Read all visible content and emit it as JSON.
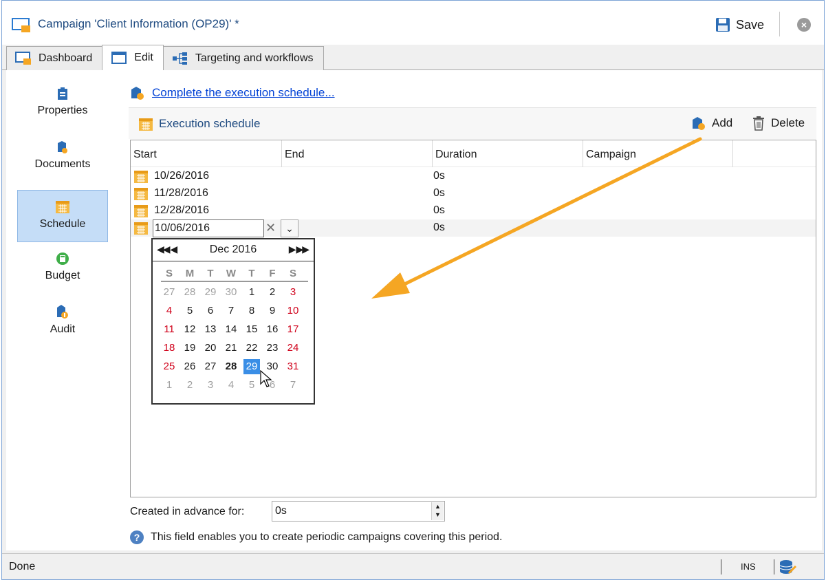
{
  "window": {
    "title": "Campaign 'Client Information (OP29)' *",
    "save_label": "Save"
  },
  "tabs": [
    {
      "label": "Dashboard"
    },
    {
      "label": "Edit"
    },
    {
      "label": "Targeting and workflows"
    }
  ],
  "sidebar": [
    {
      "label": "Properties",
      "icon": "clipboard-icon"
    },
    {
      "label": "Documents",
      "icon": "document-icon"
    },
    {
      "label": "Schedule",
      "icon": "calendar-icon",
      "active": true
    },
    {
      "label": "Budget",
      "icon": "budget-icon"
    },
    {
      "label": "Audit",
      "icon": "audit-icon"
    }
  ],
  "main": {
    "link": "Complete the execution schedule...",
    "toolbar_title": "Execution schedule",
    "add_label": "Add",
    "delete_label": "Delete"
  },
  "grid": {
    "columns": [
      "Start",
      "End",
      "Duration",
      "Campaign"
    ],
    "rows": [
      {
        "start": "10/26/2016",
        "end": "",
        "duration": "0s",
        "campaign": ""
      },
      {
        "start": "11/28/2016",
        "end": "",
        "duration": "0s",
        "campaign": ""
      },
      {
        "start": "12/28/2016",
        "end": "",
        "duration": "0s",
        "campaign": ""
      },
      {
        "start": "10/06/2016",
        "end": "",
        "duration": "0s",
        "campaign": "",
        "editing": true
      }
    ]
  },
  "calendar": {
    "month_label": "Dec 2016",
    "weekdays": [
      "S",
      "M",
      "T",
      "W",
      "T",
      "F",
      "S"
    ],
    "weeks": [
      [
        "27",
        "28",
        "29",
        "30",
        "1",
        "2",
        "3"
      ],
      [
        "4",
        "5",
        "6",
        "7",
        "8",
        "9",
        "10"
      ],
      [
        "11",
        "12",
        "13",
        "14",
        "15",
        "16",
        "17"
      ],
      [
        "18",
        "19",
        "20",
        "21",
        "22",
        "23",
        "24"
      ],
      [
        "25",
        "26",
        "27",
        "28",
        "29",
        "30",
        "31"
      ],
      [
        "1",
        "2",
        "3",
        "4",
        "5",
        "6",
        "7"
      ]
    ],
    "today": "28",
    "selected": "29"
  },
  "advance": {
    "label": "Created in advance for:",
    "value": "0s"
  },
  "help": {
    "text": "This field enables you to create periodic campaigns covering this period."
  },
  "status": {
    "text": "Done",
    "mode": "INS"
  },
  "colors": {
    "accent": "#3a8ee6",
    "weekend": "#d0021b",
    "annotation_arrow": "#f5a623",
    "link": "#0645d6"
  }
}
